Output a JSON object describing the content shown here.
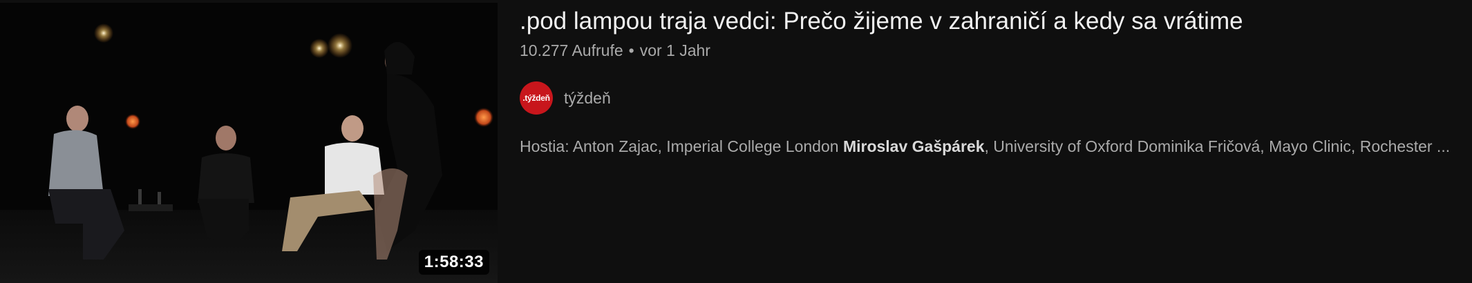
{
  "video": {
    "title": ".pod lampou traja vedci: Prečo žijeme v zahraničí a kedy sa vrátime",
    "views": "10.277 Aufrufe",
    "separator": "•",
    "age": "vor 1 Jahr",
    "duration": "1:58:33"
  },
  "channel": {
    "name": "týždeň",
    "avatar_text": ".týždeň",
    "avatar_color": "#c8161c"
  },
  "description": {
    "part1": "Hostia: Anton Zajac, Imperial College London ",
    "highlight": "Miroslav Gašpárek",
    "part2": ", University of Oxford Dominika Fričová, Mayo Clinic, Rochester ..."
  },
  "colors": {
    "background": "#0f0f0f",
    "primary_text": "#f1f1f1",
    "secondary_text": "#aaaaaa"
  }
}
